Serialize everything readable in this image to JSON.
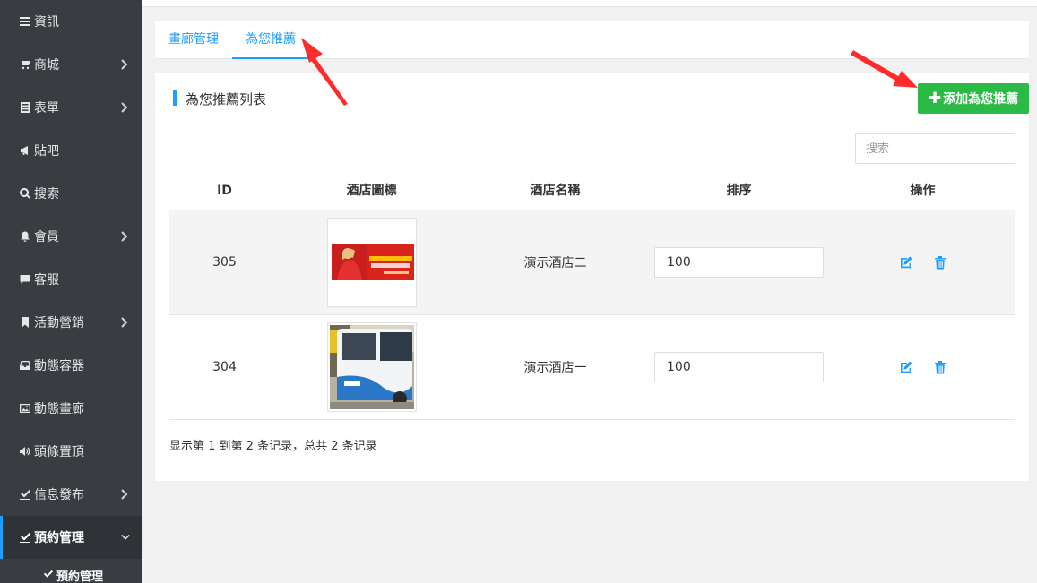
{
  "sidebar": {
    "items": [
      {
        "label": "資訊",
        "icon": "list-icon",
        "has_children": false
      },
      {
        "label": "商城",
        "icon": "cart-icon",
        "has_children": true
      },
      {
        "label": "表單",
        "icon": "form-icon",
        "has_children": true
      },
      {
        "label": "貼吧",
        "icon": "bullhorn-icon",
        "has_children": false
      },
      {
        "label": "搜索",
        "icon": "search-icon",
        "has_children": false
      },
      {
        "label": "會員",
        "icon": "bell-icon",
        "has_children": true
      },
      {
        "label": "客服",
        "icon": "chat-icon",
        "has_children": false
      },
      {
        "label": "活動營銷",
        "icon": "bookmark-icon",
        "has_children": true
      },
      {
        "label": "動態容器",
        "icon": "inbox-icon",
        "has_children": false
      },
      {
        "label": "動態畫廊",
        "icon": "picture-icon",
        "has_children": false
      },
      {
        "label": "頭條置頂",
        "icon": "volume-icon",
        "has_children": false
      },
      {
        "label": "信息發布",
        "icon": "check-square-icon",
        "has_children": true
      },
      {
        "label": "預約管理",
        "icon": "check-square-icon",
        "has_children": true,
        "active": true,
        "expanded": true
      }
    ],
    "sub_item": {
      "label": "預約管理",
      "icon": "check-icon"
    }
  },
  "tabs": [
    {
      "label": "畫廊管理",
      "active": false
    },
    {
      "label": "為您推薦",
      "active": true
    }
  ],
  "panel": {
    "title": "為您推薦列表",
    "add_button": {
      "icon": "plus",
      "label": "添加為您推薦"
    }
  },
  "search": {
    "placeholder": "搜索",
    "value": ""
  },
  "table": {
    "headers": [
      "ID",
      "酒店圖標",
      "酒店名稱",
      "排序",
      "操作"
    ],
    "rows": [
      {
        "id": "305",
        "image": "red-banner-thumbnail",
        "name": "演示酒店二",
        "sort": "100"
      },
      {
        "id": "304",
        "image": "bus-thumbnail",
        "name": "演示酒店一",
        "sort": "100"
      }
    ]
  },
  "pagination": {
    "summary": "显示第 1 到第 2 条记录，总共 2 条记录"
  },
  "colors": {
    "sidebar_bg": "#393d41",
    "accent": "#1e9fff",
    "add_button": "#2bba45",
    "annotation_arrow": "#ff2a2a"
  }
}
